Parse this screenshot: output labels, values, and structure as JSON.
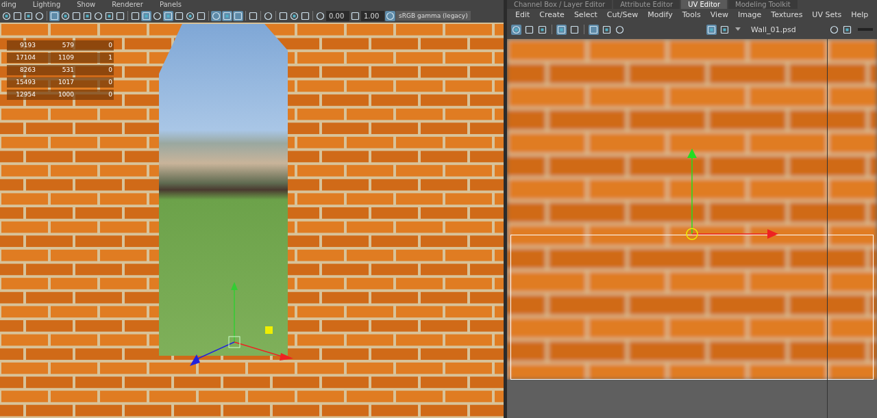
{
  "viewport": {
    "menu": [
      "ding",
      "Lighting",
      "Show",
      "Renderer",
      "Panels"
    ],
    "exposure": "0.00",
    "gamma": "1.00",
    "color_space": "sRGB gamma (legacy)",
    "hud_rows": [
      [
        "9193",
        "579",
        "0"
      ],
      [
        "17104",
        "1109",
        "1"
      ],
      [
        "8263",
        "531",
        "0"
      ],
      [
        "15493",
        "1017",
        "0"
      ],
      [
        "12954",
        "1000",
        "0"
      ]
    ]
  },
  "uv_editor": {
    "tabs": [
      {
        "label": "Channel Box / Layer Editor",
        "selected": false
      },
      {
        "label": "Attribute Editor",
        "selected": false
      },
      {
        "label": "UV Editor",
        "selected": true
      },
      {
        "label": "Modeling Toolkit",
        "selected": false
      }
    ],
    "menu": [
      "Edit",
      "Create",
      "Select",
      "Cut/Sew",
      "Modify",
      "Tools",
      "View",
      "Image",
      "Textures",
      "UV Sets",
      "Help"
    ],
    "texture": "Wall_01.psd"
  }
}
